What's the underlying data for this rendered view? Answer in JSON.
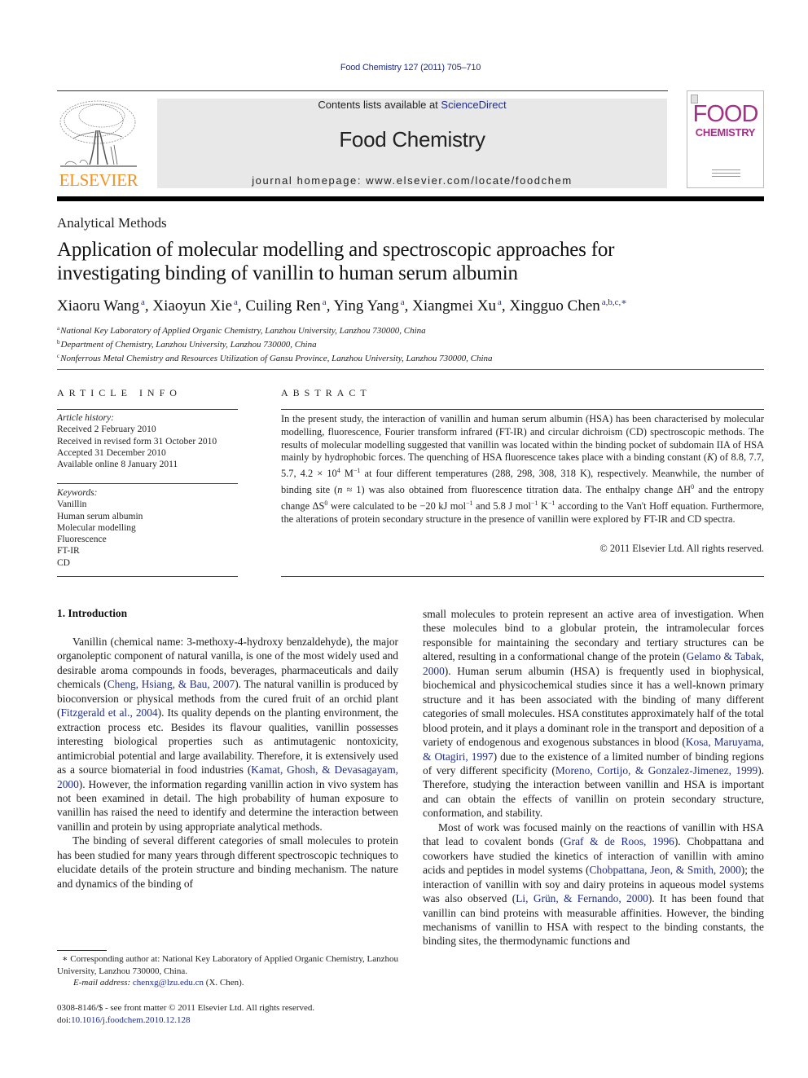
{
  "journal_ref": "Food Chemistry 127 (2011) 705–710",
  "masthead": {
    "contents_prefix": "Contents lists available at ",
    "contents_link": "ScienceDirect",
    "journal_title": "Food Chemistry",
    "homepage": "journal homepage: www.elsevier.com/locate/foodchem"
  },
  "publisher_logo": {
    "word": "ELSEVIER",
    "color": "#f39224"
  },
  "cover": {
    "line1": "FOOD",
    "line2": "CHEMISTRY",
    "color": "#a43187"
  },
  "section_label": "Analytical Methods",
  "title_line1": "Application of molecular modelling and spectroscopic approaches for",
  "title_line2": "investigating binding of vanillin to human serum albumin",
  "authors": [
    {
      "name": "Xiaoru Wang",
      "aff": "a"
    },
    {
      "name": "Xiaoyun Xie",
      "aff": "a"
    },
    {
      "name": "Cuiling Ren",
      "aff": "a"
    },
    {
      "name": "Ying Yang",
      "aff": "a"
    },
    {
      "name": "Xiangmei Xu",
      "aff": "a"
    },
    {
      "name": "Xingguo Chen",
      "aff": "a,b,c,∗"
    }
  ],
  "affiliations": [
    {
      "mark": "a",
      "text": "National Key Laboratory of Applied Organic Chemistry, Lanzhou University, Lanzhou 730000, China"
    },
    {
      "mark": "b",
      "text": "Department of Chemistry, Lanzhou University, Lanzhou 730000, China"
    },
    {
      "mark": "c",
      "text": "Nonferrous Metal Chemistry and Resources Utilization of Gansu Province, Lanzhou University, Lanzhou 730000, China"
    }
  ],
  "article_info": {
    "heading": "ARTICLE INFO",
    "history_label": "Article history:",
    "history": [
      "Received 2 February 2010",
      "Received in revised form 31 October 2010",
      "Accepted 31 December 2010",
      "Available online 8 January 2011"
    ],
    "keywords_label": "Keywords:",
    "keywords": [
      "Vanillin",
      "Human serum albumin",
      "Molecular modelling",
      "Fluorescence",
      "FT-IR",
      "CD"
    ]
  },
  "abstract": {
    "heading": "ABSTRACT",
    "p1": "In the present study, the interaction of vanillin and human serum albumin (HSA) has been characterised by molecular modelling, fluorescence, Fourier transform infrared (FT-IR) and circular dichroism (CD) spectroscopic methods. The results of molecular modelling suggested that vanillin was located within the binding pocket of subdomain IIA of HSA mainly by hydrophobic forces. The quenching of HSA fluorescence takes place with a binding constant (",
    "k": "K",
    "p2": ") of 8.8, 7.7, 5.7, 4.2 × 10",
    "exp4": "4",
    "p3": " M",
    "exp_m1": "−1",
    "p4": " at four different temperatures (288, 298, 308, 318 K), respectively. Meanwhile, the number of binding site (",
    "n": "n",
    "p5": " ≈ 1) was also obtained from fluorescence titration data. The enthalpy change ΔH",
    "zero": "0",
    "p6": " and the entropy change ΔS",
    "p7": " were calculated to be −20 kJ mol",
    "p8": " and 5.8 J mol",
    "p9": " K",
    "p10": " according to the Van't Hoff equation. Furthermore, the alterations of protein secondary structure in the presence of vanillin were explored by FT-IR and CD spectra.",
    "copyright": "© 2011 Elsevier Ltd. All rights reserved."
  },
  "intro": {
    "heading": "1. Introduction",
    "left": [
      {
        "segments": [
          {
            "t": "Vanillin (chemical name: 3-methoxy-4-hydroxy benzaldehyde), the major organoleptic component of natural vanilla, is one of the most widely used and desirable aroma compounds in foods, beverages, pharmaceuticals and daily chemicals ("
          },
          {
            "t": "Cheng, Hsiang, & Bau, 2007",
            "link": true
          },
          {
            "t": "). The natural vanillin is produced by bioconversion or physical methods from the cured fruit of an orchid plant ("
          },
          {
            "t": "Fitzgerald et al., 2004",
            "link": true
          },
          {
            "t": "). Its quality depends on the planting environment, the extraction process etc. Besides its flavour qualities, vanillin possesses interesting biological properties such as antimutagenic nontoxicity, antimicrobial potential and large availability. Therefore, it is extensively used as a source biomaterial in food industries ("
          },
          {
            "t": "Kamat, Ghosh, & Devasagayam, 2000",
            "link": true
          },
          {
            "t": "). However, the information regarding vanillin action in vivo system has not been examined in detail. The high probability of human exposure to vanillin has raised the need to identify and determine the interaction between vanillin and protein by using appropriate analytical methods."
          }
        ]
      },
      {
        "segments": [
          {
            "t": "The binding of several different categories of small molecules to protein has been studied for many years through different spectroscopic techniques to elucidate details of the protein structure and binding mechanism. The nature and dynamics of the binding of"
          }
        ]
      }
    ],
    "right": [
      {
        "noindent": true,
        "segments": [
          {
            "t": "small molecules to protein represent an active area of investigation. When these molecules bind to a globular protein, the intramolecular forces responsible for maintaining the secondary and tertiary structures can be altered, resulting in a conformational change of the protein ("
          },
          {
            "t": "Gelamo & Tabak, 2000",
            "link": true
          },
          {
            "t": "). Human serum albumin (HSA) is frequently used in biophysical, biochemical and physicochemical studies since it has a well-known primary structure and it has been associated with the binding of many different categories of small molecules. HSA constitutes approximately half of the total blood protein, and it plays a dominant role in the transport and deposition of a variety of endogenous and exogenous substances in blood ("
          },
          {
            "t": "Kosa, Maruyama, & Otagiri, 1997",
            "link": true
          },
          {
            "t": ") due to the existence of a limited number of binding regions of very different specificity ("
          },
          {
            "t": "Moreno, Cortijo, & Gonzalez-Jimenez, 1999",
            "link": true
          },
          {
            "t": "). Therefore, studying the interaction between vanillin and HSA is important and can obtain the effects of vanillin on protein secondary structure, conformation, and stability."
          }
        ]
      },
      {
        "segments": [
          {
            "t": "Most of work was focused mainly on the reactions of vanillin with HSA that lead to covalent bonds ("
          },
          {
            "t": "Graf & de Roos, 1996",
            "link": true
          },
          {
            "t": "). Chobpattana and coworkers have studied the kinetics of interaction of vanillin with amino acids and peptides in model systems ("
          },
          {
            "t": "Chobpattana, Jeon, & Smith, 2000",
            "link": true
          },
          {
            "t": "); the interaction of vanillin with soy and dairy proteins in aqueous model systems was also observed ("
          },
          {
            "t": "Li, Grün, & Fernando, 2000",
            "link": true
          },
          {
            "t": "). It has been found that vanillin can bind proteins with measurable affinities. However, the binding mechanisms of vanillin to HSA with respect to the binding constants, the binding sites, the thermodynamic functions and"
          }
        ]
      }
    ]
  },
  "footnote": {
    "star": "∗",
    "corresponding": " Corresponding author at: National Key Laboratory of Applied Organic Chemistry, Lanzhou University, Lanzhou 730000, China.",
    "email_label": "E-mail address: ",
    "email": "chenxg@lzu.edu.cn",
    "email_suffix": " (X. Chen)."
  },
  "issn_line": "0308-8146/$ - see front matter © 2011 Elsevier Ltd. All rights reserved.",
  "doi_prefix": "doi:",
  "doi": "10.1016/j.foodchem.2010.12.128"
}
